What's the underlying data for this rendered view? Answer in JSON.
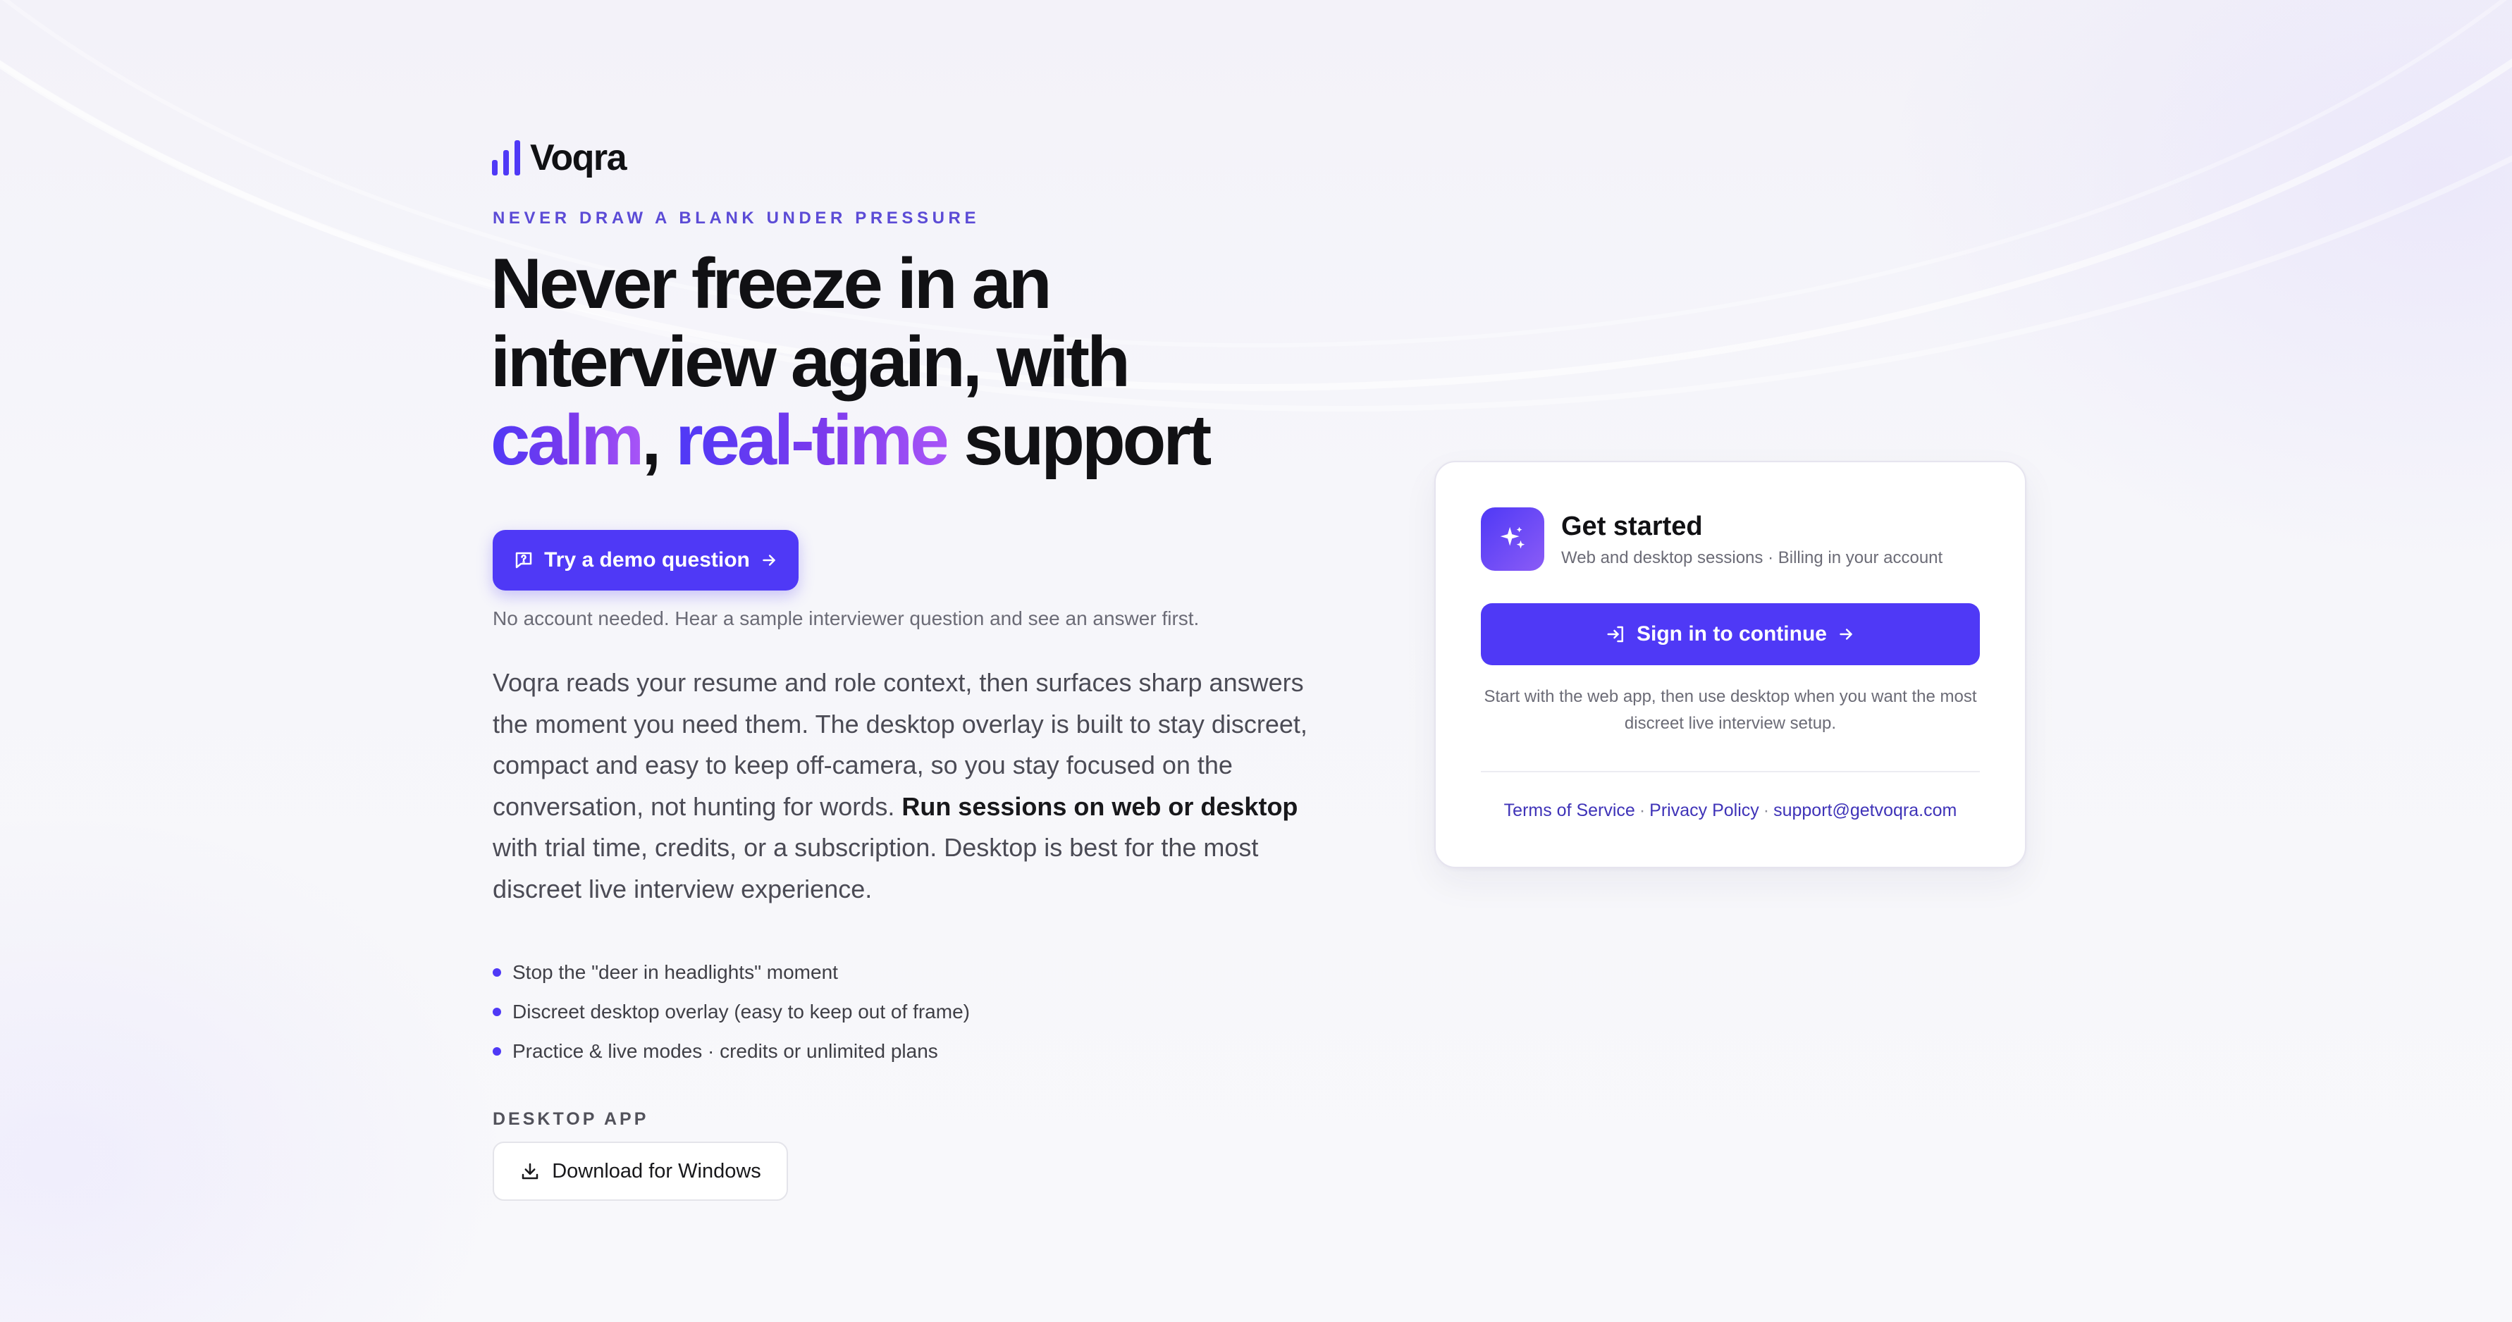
{
  "brand": {
    "name": "Voqra",
    "accent_color": "#4f39f6"
  },
  "hero": {
    "eyebrow": "NEVER DRAW A BLANK UNDER PRESSURE",
    "headline_line1": "Never freeze in an",
    "headline_line2": "interview again, with",
    "headline_highlight1": "calm",
    "headline_comma": ",",
    "headline_highlight2": "real-time",
    "headline_end": "support",
    "demo_button_label": "Try a demo question",
    "demo_note": "No account needed. Hear a sample interviewer question and see an answer first.",
    "description_part1": "Voqra reads your resume and role context, then surfaces sharp answers the moment you need them. The desktop overlay is built to stay discreet, compact and easy to keep off-camera, so you stay focused on the conversation, not hunting for words. ",
    "description_bold": "Run sessions on web or desktop",
    "description_part2": " with trial time, credits, or a subscription. Desktop is best for the most discreet live interview experience.",
    "bullets": [
      "Stop the \"deer in headlights\" moment",
      "Discreet desktop overlay (easy to keep out of frame)",
      "Practice & live modes · credits or unlimited plans"
    ]
  },
  "desktop": {
    "label": "DESKTOP APP",
    "download_label": "Download for Windows"
  },
  "card": {
    "title": "Get started",
    "subtitle": "Web and desktop sessions · Billing in your account",
    "signin_label": "Sign in to continue",
    "note": "Start with the web app, then use desktop when you want the most discreet live interview setup.",
    "links": {
      "terms": "Terms of Service",
      "privacy": "Privacy Policy",
      "support": "support@getvoqra.com",
      "separator": "·"
    }
  }
}
